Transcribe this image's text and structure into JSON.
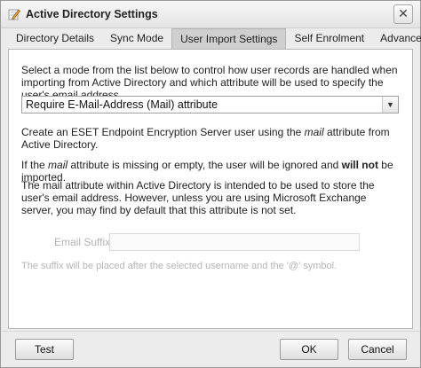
{
  "window": {
    "title": "Active Directory Settings",
    "close_glyph": "✕"
  },
  "tabs": [
    {
      "label": "Directory Details"
    },
    {
      "label": "Sync Mode"
    },
    {
      "label": "User Import Settings"
    },
    {
      "label": "Self Enrolment"
    },
    {
      "label": "Advanced"
    }
  ],
  "active_tab": "User Import Settings",
  "content": {
    "intro": "Select a mode from the list below to control how user records are handled when importing from Active Directory and which attribute will be used to specify the user's email address.",
    "mode_select": {
      "value": "Require E-Mail-Address (Mail) attribute"
    },
    "desc1_a": "Create an ESET Endpoint Encryption Server user using the ",
    "desc1_attr": "mail",
    "desc1_b": " attribute from Active Directory.",
    "desc2_a": "If the ",
    "desc2_attr": "mail",
    "desc2_b": " attribute is missing or empty, the user will be ignored and ",
    "desc2_bold": "will not",
    "desc2_c": " be imported.",
    "desc3": "The mail attribute within Active Directory is intended to be used to store the user's email address. However, unless you are using Microsoft Exchange server, you may find by default that this attribute is not set.",
    "email_suffix_label": "Email Suffix",
    "email_suffix_value": "",
    "suffix_hint": "The suffix will be placed after the selected username and the '@' symbol."
  },
  "buttons": {
    "test": "Test",
    "ok": "OK",
    "cancel": "Cancel"
  },
  "icons": {
    "title": "pencil-icon",
    "dropdown": "chevron-down-icon"
  }
}
